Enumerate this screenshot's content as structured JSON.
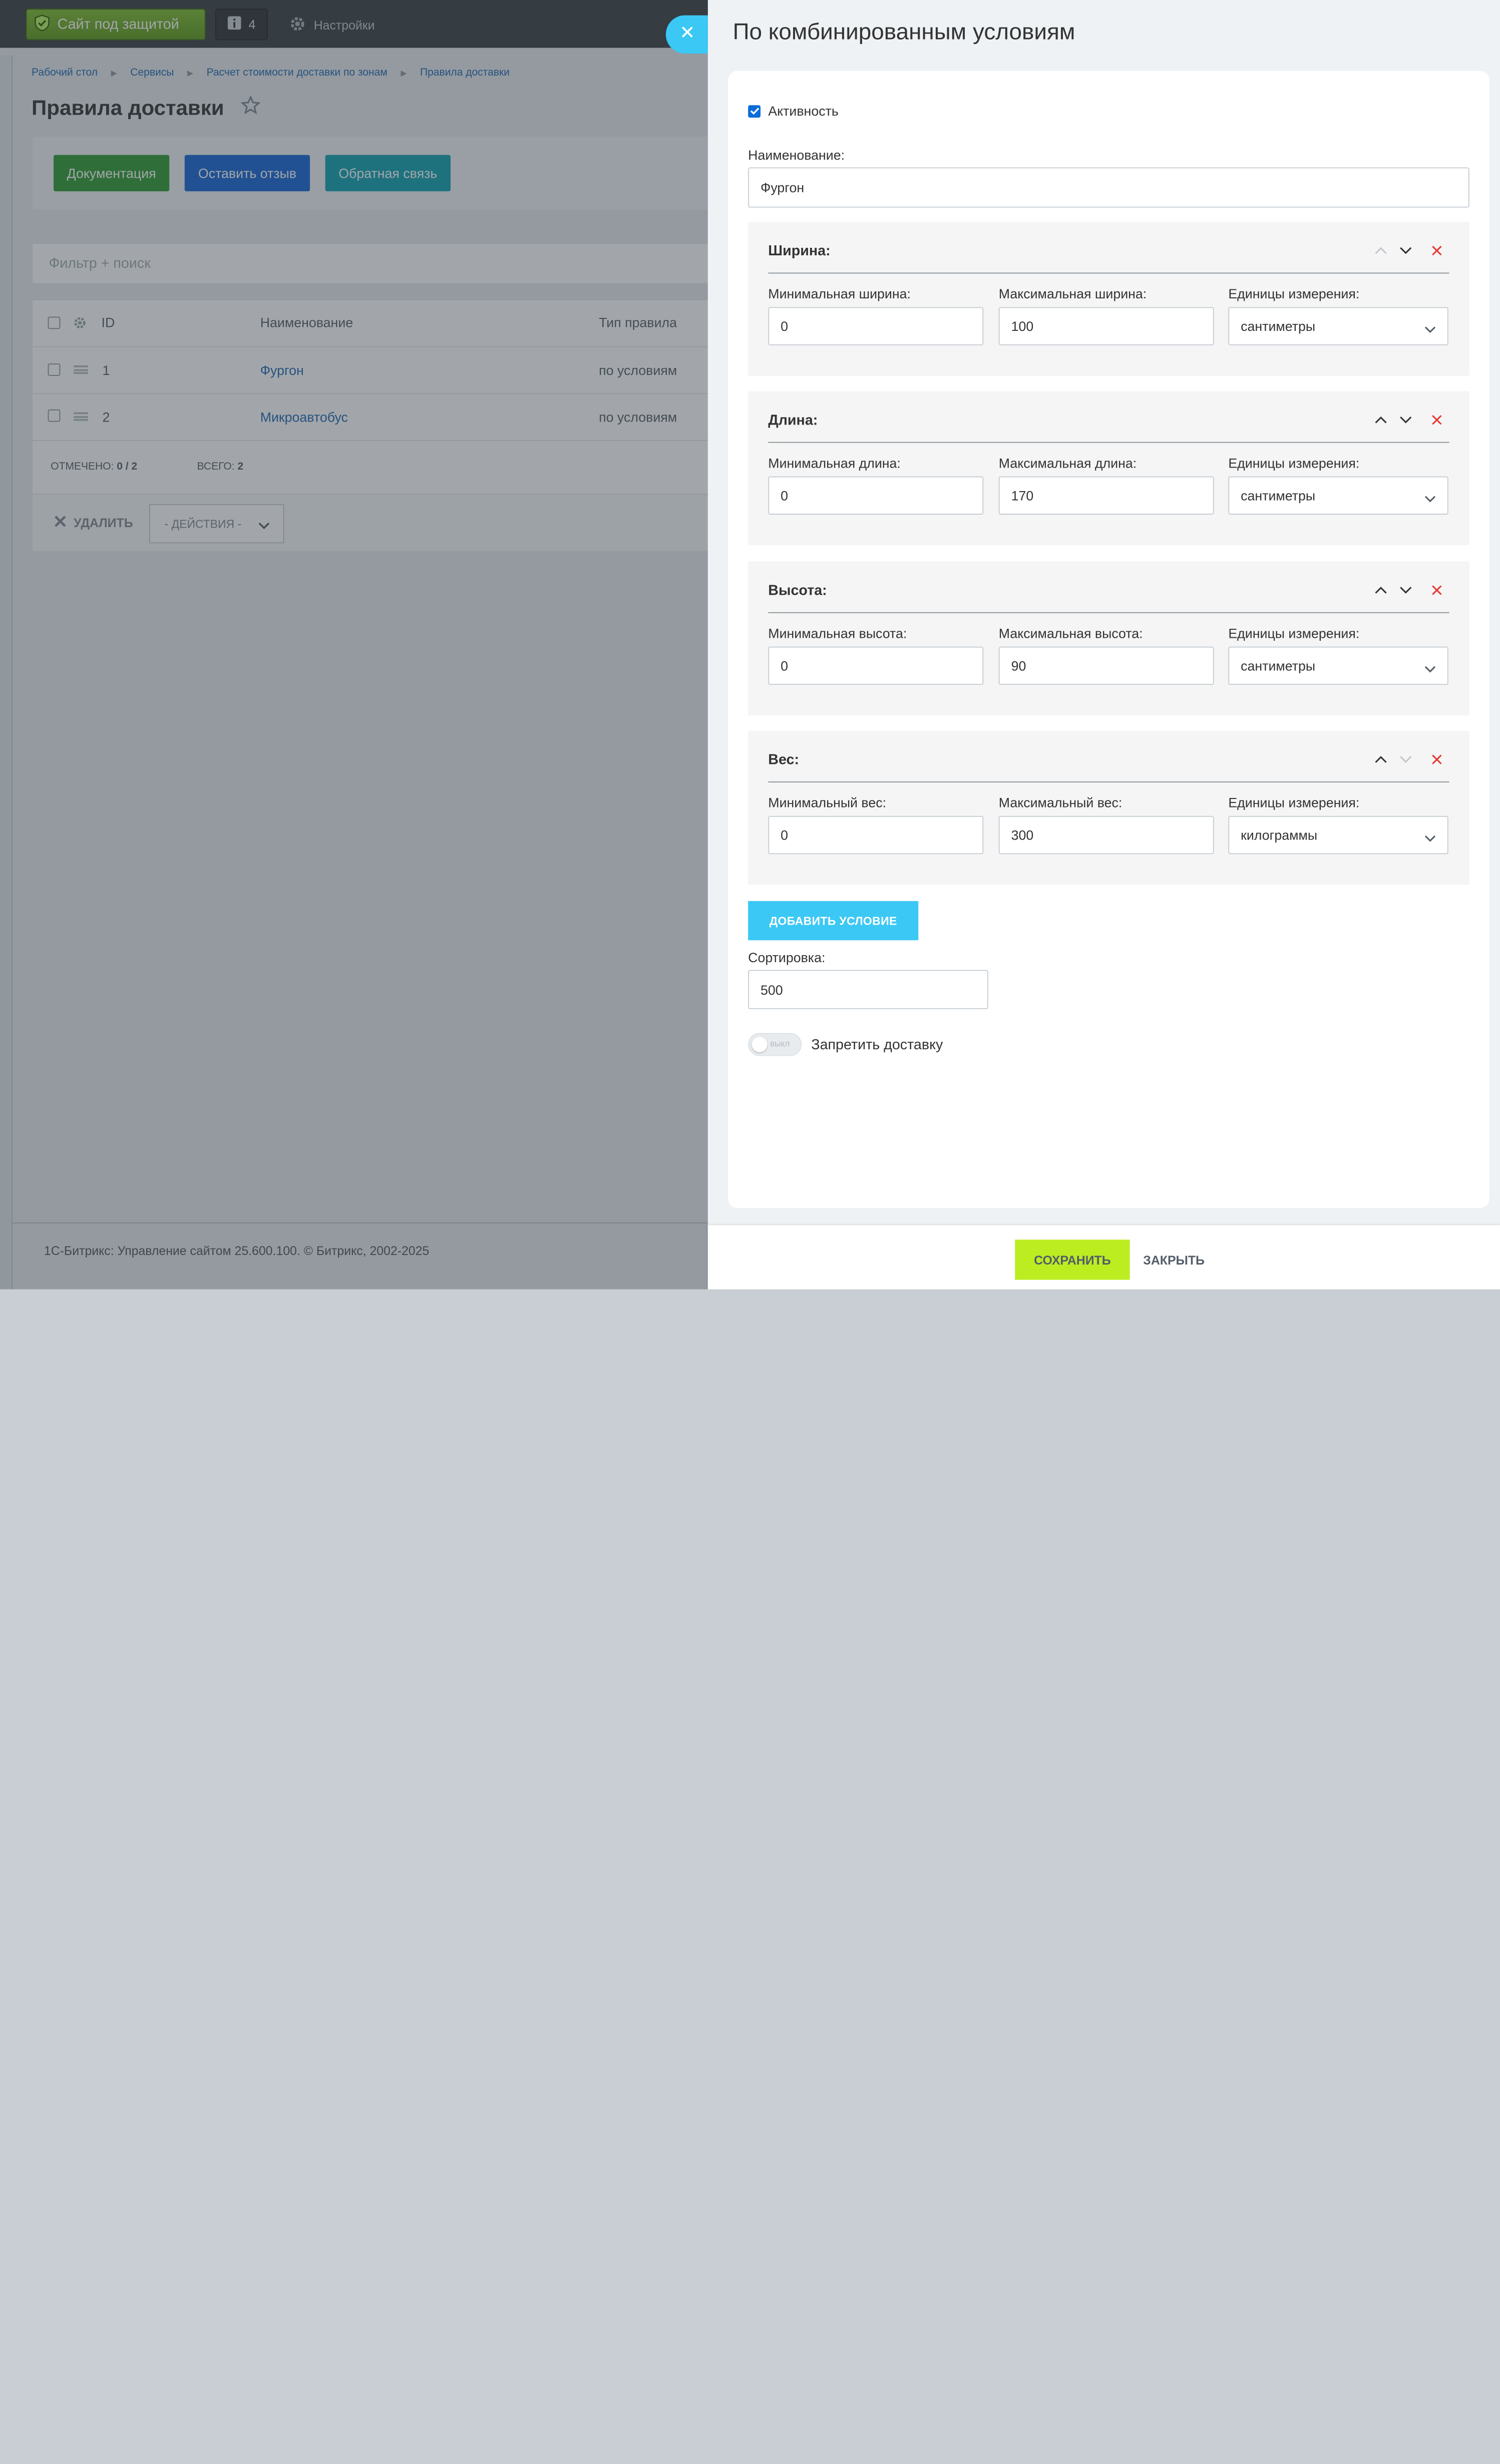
{
  "topbar": {
    "protect_label": "Сайт под защитой",
    "notif_count": "4",
    "settings_label": "Настройки"
  },
  "breadcrumb": [
    "Рабочий стол",
    "Сервисы",
    "Расчет стоимости доставки по зонам",
    "Правила доставки"
  ],
  "page_title": "Правила доставки",
  "toolbar": {
    "doc_label": "Документация",
    "feedback_label": "Оставить отзыв",
    "contact_label": "Обратная связь"
  },
  "filter_placeholder": "Фильтр + поиск",
  "grid": {
    "headers": {
      "id": "ID",
      "name": "Наименование",
      "type": "Тип правила"
    },
    "rows": [
      {
        "id": "1",
        "name": "Фургон",
        "type": "по условиям"
      },
      {
        "id": "2",
        "name": "Микроавтобус",
        "type": "по условиям"
      }
    ],
    "footer": {
      "marked_label": "ОТМЕЧЕНО:",
      "marked_value": "0 / 2",
      "total_label": "ВСЕГО:",
      "total_value": "2"
    },
    "delete_label": "УДАЛИТЬ",
    "actions_label": "- ДЕЙСТВИЯ -"
  },
  "page_footer": "1С-Битрикс: Управление сайтом 25.600.100. © Битрикс, 2002-2025",
  "panel": {
    "title": "По комбинированным условиям",
    "active_label": "Активность",
    "name_label": "Наименование:",
    "name_value": "Фургон",
    "sections": [
      {
        "title": "Ширина:",
        "min_label": "Минимальная ширина:",
        "min_value": "0",
        "max_label": "Максимальная ширина:",
        "max_value": "100",
        "unit_label": "Единицы измерения:",
        "unit_value": "сантиметры"
      },
      {
        "title": "Длина:",
        "min_label": "Минимальная длина:",
        "min_value": "0",
        "max_label": "Максимальная длина:",
        "max_value": "170",
        "unit_label": "Единицы измерения:",
        "unit_value": "сантиметры"
      },
      {
        "title": "Высота:",
        "min_label": "Минимальная высота:",
        "min_value": "0",
        "max_label": "Максимальная высота:",
        "max_value": "90",
        "unit_label": "Единицы измерения:",
        "unit_value": "сантиметры"
      },
      {
        "title": "Вес:",
        "min_label": "Минимальный вес:",
        "min_value": "0",
        "max_label": "Максимальный вес:",
        "max_value": "300",
        "unit_label": "Единицы измерения:",
        "unit_value": "килограммы"
      }
    ],
    "add_condition_label": "ДОБАВИТЬ УСЛОВИЕ",
    "sort_label": "Сортировка:",
    "sort_value": "500",
    "switch_off_label": "выкл",
    "forbid_label": "Запретить доставку",
    "save_label": "СОХРАНИТЬ",
    "close_label": "ЗАКРЫТЬ"
  },
  "colors": {
    "accent": "#3bc8f5",
    "save": "#bbed21",
    "delete_x": "#e53935",
    "link": "#2067b0"
  }
}
